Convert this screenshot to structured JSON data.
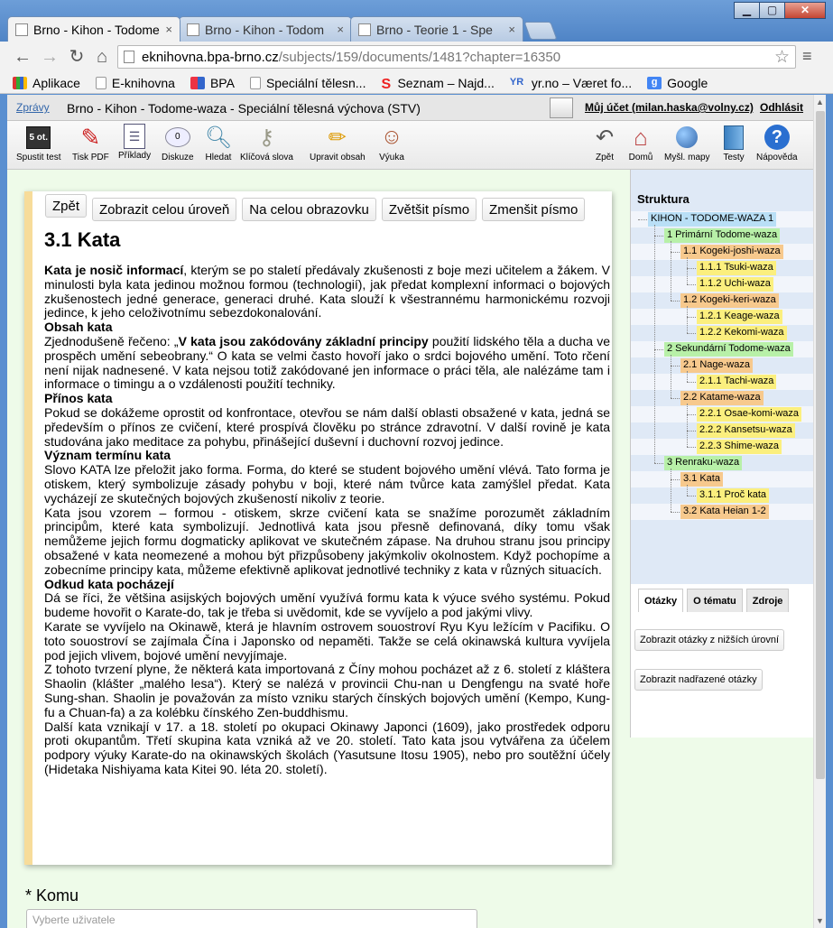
{
  "browser": {
    "tabs": [
      {
        "label": "Brno - Kihon - Todome",
        "active": true
      },
      {
        "label": "Brno - Kihon - Todom",
        "active": false
      },
      {
        "label": "Brno - Teorie 1 - Spe",
        "active": false
      }
    ],
    "tab_close": "×",
    "url_host": "eknihovna.bpa-brno.cz",
    "url_path": "/subjects/159/documents/1481?chapter=16350",
    "bookmarks": [
      "Aplikace",
      "E-knihovna",
      "BPA",
      "Speciální tělesn...",
      "Seznam – Najd...",
      "yr.no – Været fo...",
      "Google"
    ],
    "bookmark_colors": [
      "#4a90d9",
      "#3c6fb4",
      "#e34",
      "#777",
      "#e22",
      "#36c",
      "#4285f4"
    ]
  },
  "header": {
    "zpravy": "Zprávy",
    "course_title": "Brno - Kihon - Todome-waza - Speciální tělesná výchova (STV)",
    "account": "Můj účet (milan.haska@volny.cz)",
    "logout": "Odhlásit"
  },
  "toolbar": {
    "left": [
      {
        "label": "Spustit test",
        "icon": "test-icon"
      },
      {
        "label": "Tisk PDF",
        "icon": "pdf-icon"
      },
      {
        "label": "Příklady",
        "icon": "list-icon"
      },
      {
        "label": "Diskuze",
        "icon": "discussion-icon"
      },
      {
        "label": "Hledat",
        "icon": "search-icon"
      },
      {
        "label": "Klíčová slova",
        "icon": "key-icon"
      },
      {
        "label": "Upravit obsah",
        "icon": "pencil-icon"
      },
      {
        "label": "Výuka",
        "icon": "teacher-icon"
      }
    ],
    "right": [
      {
        "label": "Zpět",
        "icon": "back-arrow-icon"
      },
      {
        "label": "Domů",
        "icon": "home-icon"
      },
      {
        "label": "Myšl. mapy",
        "icon": "globe-icon"
      },
      {
        "label": "Testy",
        "icon": "book-icon"
      },
      {
        "label": "Nápověda",
        "icon": "help-icon"
      }
    ],
    "test_badge": "5 ot.",
    "discussion_badge": "0"
  },
  "content": {
    "buttons": {
      "back": "Zpět",
      "show_level": "Zobrazit celou úroveň",
      "fullscreen": "Na celou obrazovku",
      "bigger": "Zvětšit písmo",
      "smaller": "Zmenšit písmo"
    },
    "title": "3.1 Kata",
    "p1_bold": "Kata je nosič informací",
    "p1_rest": ", kterým se po staletí předávaly zkušenosti z boje mezi učitelem a žákem. V minulosti byla kata jedinou možnou formou (technologií), jak předat komplexní informaci o bojových zkušenostech jedné generace, generaci druhé. Kata slouží k všestrannému harmonickému rozvoji jedince, k jeho celoživotnímu sebezdokonalování.",
    "h_obsah": "Obsah kata",
    "p2_pre": "Zjednodušeně řečeno: „",
    "p2_bold": "V kata jsou zakódovány základní principy",
    "p2_rest": " použití lidského těla a ducha ve prospěch umění sebeobrany.“ O kata se velmi často hovoří jako o srdci bojového umění. Toto rčení není nijak nadnesené. V kata nejsou totiž zakódované jen informace o práci těla, ale nalézáme tam i informace o timingu a o vzdálenosti použití techniky.",
    "h_prinos": "Přínos kata",
    "p3": "Pokud se dokážeme oprostit od konfrontace, otevřou se nám další oblasti obsažené v kata, jedná se především o přínos ze cvičení, které prospívá člověku po stránce zdravotní. V další rovině je kata studována jako meditace za pohybu, přinášející duševní i duchovní rozvoj jedince.",
    "h_vyznam": "Význam termínu kata",
    "p4": "Slovo KATA lze přeložit jako forma. Forma, do které se student bojového umění vlévá. Tato forma je otiskem, který symbolizuje zásady pohybu v boji, které nám tvůrce kata zamýšlel předat. Kata vycházejí ze skutečných bojových zkušeností nikoliv z teorie.",
    "p5": "Kata jsou vzorem – formou - otiskem, skrze cvičení kata se snažíme porozumět základním principům, které kata symbolizují. Jednotlivá kata jsou přesně definovaná, díky tomu však nemůžeme jejich formu dogmaticky aplikovat ve skutečném zápase. Na druhou stranu jsou principy obsažené v kata neomezené a mohou být přizpůsobeny jakýmkoliv okolnostem. Když pochopíme a zobecníme principy kata, můžeme efektivně aplikovat jednotlivé techniky z kata v různých situacích.",
    "h_odkud": "Odkud kata pocházejí",
    "p6": "Dá se říci, že většina asijských bojových umění využívá formu kata k výuce svého systému. Pokud budeme hovořit o Karate-do, tak je třeba si uvědomit, kde se vyvíjelo a pod jakými vlivy.",
    "p7": "Karate se vyvíjelo na Okinawě, která je hlavním ostrovem souostroví Ryu Kyu ležícím v Pacifiku. O toto souostroví se zajímala Čína i Japonsko od nepaměti. Takže se celá okinawská kultura vyvíjela pod jejich vlivem, bojové umění nevyjímaje.",
    "p8": "Z tohoto tvrzení plyne, že některá kata importovaná z Číny mohou pocházet až z 6. století z kláštera Shaolin (klášter „malého lesa“). Který se nalézá v provincii Chu-nan u Dengfengu na svaté hoře Sung-shan. Shaolin je považován za místo vzniku starých čínských bojových umění (Kempo, Kung-fu a Chuan-fa) a za kolébku čínského Zen-buddhismu.",
    "p9": "Další kata vznikají v 17. a 18. století po okupaci Okinawy Japonci (1609), jako prostředek odporu proti okupantům. Třetí skupina kata vzniká až ve 20. století. Tato kata jsou vytvářena za účelem podpory výuky Karate-do na okinawských školách (Yasutsune Itosu 1905), nebo pro soutěžní účely (Hidetaka Nishiyama kata Kitei 90. léta 20. století).",
    "komu_label": "* Komu",
    "komu_placeholder": "Vyberte uživatele"
  },
  "structure": {
    "title": "Struktura",
    "nodes": [
      {
        "label": "KIHON - TODOME-WAZA 1",
        "level": 0
      },
      {
        "label": "1 Primární Todome-waza",
        "level": 1
      },
      {
        "label": "1.1 Kogeki-joshi-waza",
        "level": 2
      },
      {
        "label": "1.1.1 Tsuki-waza",
        "level": 3
      },
      {
        "label": "1.1.2 Uchi-waza",
        "level": 3
      },
      {
        "label": "1.2 Kogeki-keri-waza",
        "level": 2
      },
      {
        "label": "1.2.1 Keage-waza",
        "level": 3
      },
      {
        "label": "1.2.2 Kekomi-waza",
        "level": 3
      },
      {
        "label": "2 Sekundární Todome-waza",
        "level": 1
      },
      {
        "label": "2.1 Nage-waza",
        "level": 2
      },
      {
        "label": "2.1.1 Tachi-waza",
        "level": 3
      },
      {
        "label": "2.2 Katame-waza",
        "level": 2
      },
      {
        "label": "2.2.1 Osae-komi-waza",
        "level": 3
      },
      {
        "label": "2.2.2 Kansetsu-waza",
        "level": 3
      },
      {
        "label": "2.2.3 Shime-waza",
        "level": 3
      },
      {
        "label": "3 Renraku-waza",
        "level": 1
      },
      {
        "label": "3.1 Kata",
        "level": 2
      },
      {
        "label": "3.1.1 Proč kata",
        "level": 3
      },
      {
        "label": "3.2 Kata Heian 1-2",
        "level": 2
      }
    ]
  },
  "questions": {
    "tabs": [
      "Otázky",
      "O tématu",
      "Zdroje"
    ],
    "show_lower": "Zobrazit otázky z nižších úrovní",
    "show_parent": "Zobrazit nadřazené otázky"
  }
}
